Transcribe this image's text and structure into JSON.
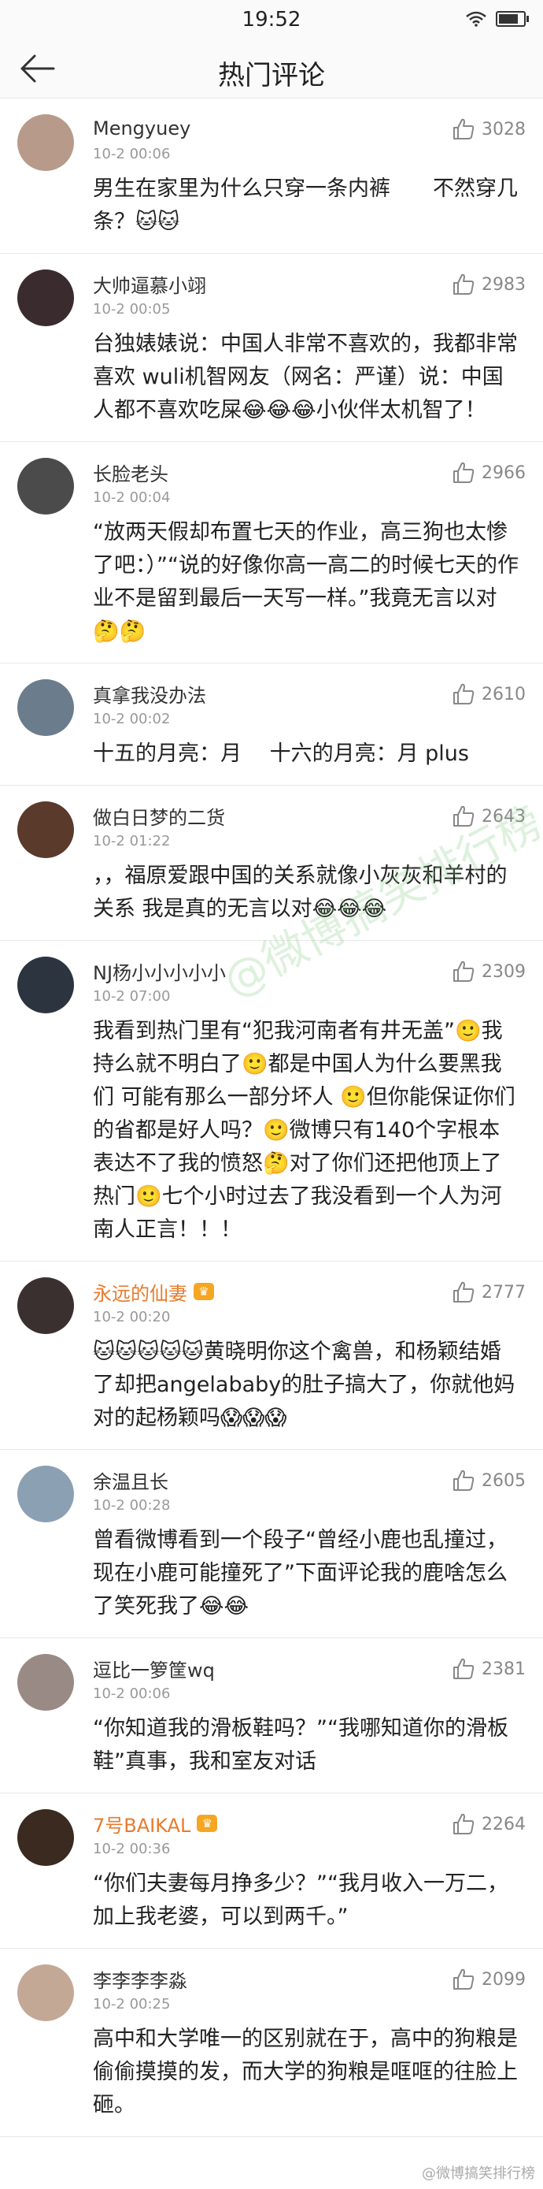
{
  "status_bar": {
    "time": "19:52"
  },
  "nav": {
    "title": "热门评论"
  },
  "comments": [
    {
      "user": "Mengyuey",
      "time": "10-2 00:06",
      "likes": "3028",
      "content": "男生在家里为什么只穿一条内裤　　不然穿几条？🐱🐱",
      "avatar_color": "#b89a8a",
      "vip": false
    },
    {
      "user": "大帅逼慕小翊",
      "time": "10-2 00:05",
      "likes": "2983",
      "content": "台独婊婊说：中国人非常不喜欢的，我都非常喜欢 wuli机智网友（网名：严谨）说：中国人都不喜欢吃屎😂😂😂小伙伴太机智了！",
      "avatar_color": "#3a2b2f",
      "vip": false
    },
    {
      "user": "长脸老头",
      "time": "10-2 00:04",
      "likes": "2966",
      "content": "“放两天假却布置七天的作业，高三狗也太惨了吧：）”“说的好像你高一高二的时候七天的作业不是留到最后一天写一样。”我竟无言以对🤔🤔",
      "avatar_color": "#4b4b4b",
      "vip": false
    },
    {
      "user": "真拿我没办法",
      "time": "10-2 00:02",
      "likes": "2610",
      "content": "十五的月亮：月　 十六的月亮：月 plus",
      "avatar_color": "#6b7c8c",
      "vip": false
    },
    {
      "user": "做白日梦的二货",
      "time": "10-2 01:22",
      "likes": "2643",
      "content": "，，福原爱跟中国的关系就像小灰灰和羊村的关系 我是真的无言以对😂😂😂",
      "avatar_color": "#5a3a2a",
      "vip": false
    },
    {
      "user": "NJ杨小小小小小",
      "time": "10-2 07:00",
      "likes": "2309",
      "content": "我看到热门里有“犯我河南者有井无盖”🙂我持么就不明白了🙂都是中国人为什么要黑我们 可能有那么一部分坏人 🙂但你能保证你们的省都是好人吗？🙂微博只有140个字根本表达不了我的愤怒🤔对了你们还把他顶上了热门🙂七个小时过去了我没看到一个人为河南人正言！！！",
      "avatar_color": "#2c3440",
      "vip": false
    },
    {
      "user": "永远的仙妻",
      "time": "10-2 00:20",
      "likes": "2777",
      "content": "🐱🐱🐱🐱🐱黄晓明你这个禽兽，和杨颖结婚了却把angelababy的肚子搞大了，你就他妈对的起杨颖吗😱😱😱",
      "avatar_color": "#3b3030",
      "vip": true
    },
    {
      "user": "余温且长",
      "time": "10-2 00:28",
      "likes": "2605",
      "content": "曾看微博看到一个段子“曾经小鹿也乱撞过，现在小鹿可能撞死了”下面评论我的鹿啥怎么了笑死我了😂😂",
      "avatar_color": "#8ca0b4",
      "vip": false
    },
    {
      "user": "逗比一箩筐wq",
      "time": "10-2 00:06",
      "likes": "2381",
      "content": "“你知道我的滑板鞋吗？”“我哪知道你的滑板鞋”真事，我和室友对话",
      "avatar_color": "#9a8a86",
      "vip": false
    },
    {
      "user": "7号BAIKAL",
      "time": "10-2 00:36",
      "likes": "2264",
      "content": "“你们夫妻每月挣多少？”“我月收入一万二，加上我老婆，可以到两千。”",
      "avatar_color": "#3a2a20",
      "vip": true
    },
    {
      "user": "李李李李淼",
      "time": "10-2 00:25",
      "likes": "2099",
      "content": "高中和大学唯一的区别就在于，高中的狗粮是偷偷摸摸的发，而大学的狗粮是哐哐的往脸上砸。",
      "avatar_color": "#c4a896",
      "vip": false
    }
  ],
  "watermark": "@微博搞笑排行榜",
  "footer": "@微博搞笑排行榜"
}
